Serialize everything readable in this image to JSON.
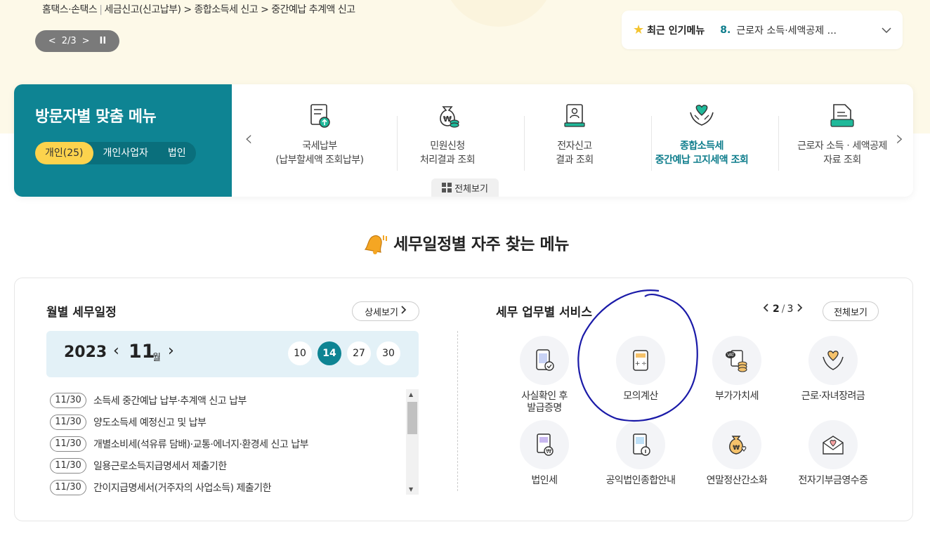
{
  "breadcrumb": {
    "home": "홈택스·손택스",
    "path": "세금신고(신고납부) > 종합소득세 신고 > 중간예납 추계액 신고"
  },
  "slider": {
    "prev": "<",
    "counter": "2/3",
    "next": ">",
    "pause": "II"
  },
  "popular": {
    "title": "최근 인기메뉴",
    "rank": "8.",
    "text": "근로자 소득·세액공제 ..."
  },
  "visitor": {
    "title": "방문자별 맞춤 메뉴",
    "tabs": [
      {
        "label": "개인(25)",
        "active": true
      },
      {
        "label": "개인사업자"
      },
      {
        "label": "법인"
      }
    ],
    "items": [
      {
        "line1": "국세납부",
        "line2": "(납부할세액 조회납부)",
        "icon": "tax-payment-icon"
      },
      {
        "line1": "민원신청",
        "line2": "처리결과 조회",
        "icon": "money-bag-icon"
      },
      {
        "line1": "전자신고",
        "line2": "결과 조회",
        "icon": "e-filing-icon"
      },
      {
        "line1": "종합소득세",
        "line2": "중간예납 고지세액 조회",
        "icon": "heart-hands-icon",
        "highlight": true
      },
      {
        "line1": "근로자 소득ㆍ세액공제",
        "line2": "자료 조회",
        "icon": "document-icon"
      }
    ],
    "see_all": "전체보기"
  },
  "section_title": "세무일정별 자주 찾는 메뉴",
  "monthly": {
    "title": "월별 세무일정",
    "detail": "상세보기",
    "year": "2023",
    "month": "11",
    "month_unit": "월",
    "days": [
      {
        "label": "10"
      },
      {
        "label": "14",
        "active": true
      },
      {
        "label": "27"
      },
      {
        "label": "30"
      }
    ],
    "events": [
      {
        "date": "11/30",
        "text": "소득세 중간예납 납부·추계액 신고 납부"
      },
      {
        "date": "11/30",
        "text": "양도소득세 예정신고 및 납부"
      },
      {
        "date": "11/30",
        "text": "개별소비세(석유류 담배)·교통·에너지·환경세 신고 납부"
      },
      {
        "date": "11/30",
        "text": "일용근로소득지급명세서 제출기한"
      },
      {
        "date": "11/30",
        "text": "간이지급명세서(거주자의 사업소득) 제출기한"
      }
    ]
  },
  "services": {
    "title": "세무 업무별 서비스",
    "page_current": "2",
    "page_sep": "/",
    "page_total": "3",
    "all": "전체보기",
    "items": [
      {
        "line1": "사실확인 후",
        "line2": "발급증명",
        "icon": "phone-certificate-icon"
      },
      {
        "line1": "모의계산",
        "line2": "",
        "icon": "calculator-icon"
      },
      {
        "line1": "부가가치세",
        "line2": "",
        "icon": "vat-coins-icon"
      },
      {
        "line1": "근로·자녀장려금",
        "line2": "",
        "icon": "heart-hands-icon"
      },
      {
        "line1": "법인세",
        "line2": "",
        "icon": "corporate-tax-icon"
      },
      {
        "line1": "공익법인종합안내",
        "line2": "",
        "icon": "public-info-icon"
      },
      {
        "line1": "연말정산간소화",
        "line2": "",
        "icon": "year-end-bag-icon"
      },
      {
        "line1": "전자기부금영수증",
        "line2": "",
        "icon": "donation-envelope-icon"
      }
    ]
  },
  "colors": {
    "teal": "#0e8493",
    "yellow": "#fcd34d",
    "annotation": "#1a1aa8"
  }
}
